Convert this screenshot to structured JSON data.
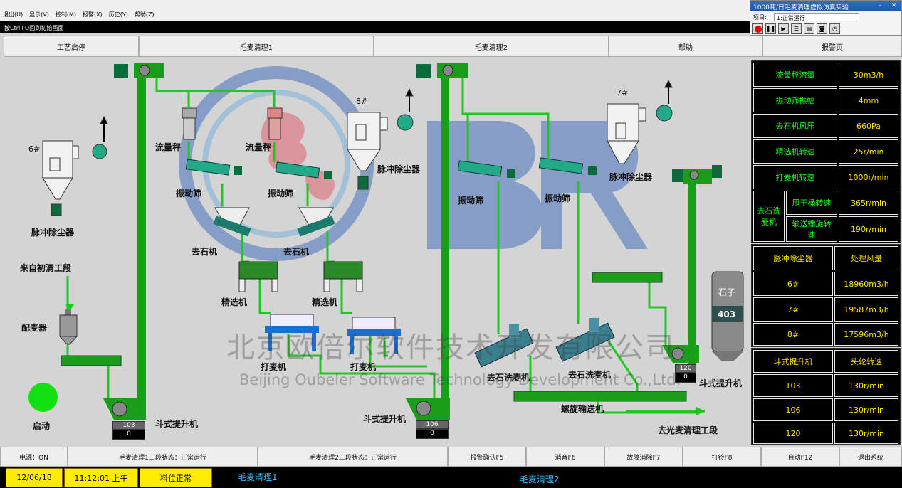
{
  "menu": [
    "退出(U)",
    "显示(V)",
    "控制(M)",
    "报警(X)",
    "历史(Y)",
    "帮助(Z)"
  ],
  "hint": "按Ctrl+O回到初始画面",
  "sim": {
    "title": "1000吨/日毛麦清理虚拟仿真实验",
    "project_label": "项目:",
    "project_value": "1:正常运行"
  },
  "nav": [
    "工艺启停",
    "毛麦清理1",
    "毛麦清理2",
    "帮助",
    "报警页"
  ],
  "params": [
    {
      "name": "流量秤流量",
      "value": "30m3/h"
    },
    {
      "name": "振动筛振幅",
      "value": "4mm"
    },
    {
      "name": "去石机风压",
      "value": "660Pa"
    },
    {
      "name": "精选机转速",
      "value": "25r/min"
    },
    {
      "name": "打麦机转速",
      "value": "1000r/min"
    }
  ],
  "washer": {
    "name": "去石洗麦机",
    "rows": [
      {
        "name": "甩干桶转速",
        "value": "365r/min"
      },
      {
        "name": "输送螺旋转速",
        "value": "190r/min"
      }
    ]
  },
  "dust": {
    "h1": "脉冲除尘器",
    "h2": "处理风量",
    "rows": [
      {
        "id": "6#",
        "value": "18960m3/h"
      },
      {
        "id": "7#",
        "value": "19587m3/h"
      },
      {
        "id": "8#",
        "value": "17596m3/h"
      }
    ]
  },
  "elev": {
    "h1": "斗式提升机",
    "h2": "头轮转速",
    "rows": [
      {
        "id": "103",
        "value": "130r/min"
      },
      {
        "id": "106",
        "value": "130r/min"
      },
      {
        "id": "120",
        "value": "130r/min"
      }
    ]
  },
  "labels": {
    "from": "来自初清工段",
    "mixer": "配麦器",
    "start": "启动",
    "dust6": "6#",
    "dust7": "7#",
    "dust8": "8#",
    "pulse": "脉冲除尘器",
    "flow": "流量秤",
    "sieve": "振动筛",
    "stoner": "去石机",
    "sel": "精选机",
    "scourer": "打麦机",
    "elev": "斗式提升机",
    "washer": "去石洗麦机",
    "screw": "螺旋输送机",
    "to": "去光麦清理工段",
    "stone": "石子",
    "stone_v": "403"
  },
  "counters": [
    {
      "id": "103",
      "v": "0"
    },
    {
      "id": "106",
      "v": "0"
    },
    {
      "id": "120",
      "v": "0"
    }
  ],
  "status": [
    "电源：ON",
    "毛麦清理1工段状态：正常运行",
    "毛麦清理2工段状态：正常运行",
    "报警确认F5",
    "消音F6",
    "故障消除F7",
    "打铃F8",
    "自动F12",
    "退出系统"
  ],
  "bottom": {
    "date": "12/06/18",
    "time": "11:12:01 上午",
    "material": "料位正常",
    "stage1": "毛麦清理1",
    "stage2": "毛麦清理2"
  },
  "watermark": {
    "cn": "北京欧倍尔软件技术开发有限公司",
    "en": "Beijing Oubeler Software Technology Development Co.,Ltd.",
    "logo": "OBR"
  },
  "colors": {
    "pipe": "#1ec81e",
    "elev": "#1a9e1a",
    "panel": "#000000",
    "value": "#ffe000",
    "label": "#19ff19"
  }
}
